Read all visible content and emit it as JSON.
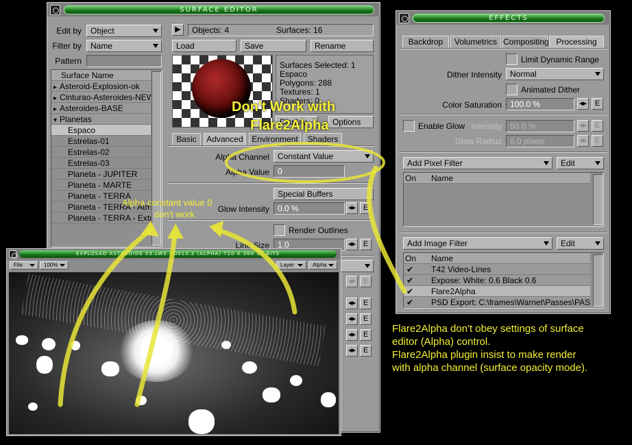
{
  "surface_editor": {
    "title": "Surface Editor",
    "edit_by_label": "Edit by",
    "edit_by_value": "Object",
    "filter_by_label": "Filter by",
    "filter_by_value": "Name",
    "pattern_label": "Pattern",
    "pattern_value": "",
    "list_header": "Surface Name",
    "groups": [
      {
        "name": "Asteroid-Explosion-ok",
        "expanded": false
      },
      {
        "name": "Cinturao-Asteroides-NEW E",
        "expanded": false
      },
      {
        "name": "Asteroides-BASE",
        "expanded": false
      },
      {
        "name": "Planetas",
        "expanded": true
      }
    ],
    "surfaces": [
      "Espaco",
      "Estrelas-01",
      "Estrelas-02",
      "Estrelas-03",
      "Planeta - JUPITER",
      "Planeta - MARTE",
      "Planeta - TERRA",
      "Planeta - TERRA - Atmo",
      "Planeta - TERRA - Extra"
    ],
    "selected_surface": "Espaco",
    "objects_text": "Objects: 4",
    "surfaces_count_text": "Surfaces: 16",
    "load_label": "Load",
    "save_label": "Save",
    "rename_label": "Rename",
    "info": [
      "Surfaces Selected: 1",
      "Espaco",
      "Polygons: 288",
      "Textures: 1",
      "Shaders: 0"
    ],
    "display_label": "Display",
    "options_label": "Options",
    "tabs": [
      "Basic",
      "Advanced",
      "Environment",
      "Shaders"
    ],
    "selected_tab": "Advanced",
    "alpha_channel_label": "Alpha Channel",
    "alpha_channel_value": "Constant Value",
    "alpha_value_label": "Alpha Value",
    "alpha_value": "0",
    "special_buffers_label": "Special Buffers",
    "glow_intensity_label": "Glow Intensity",
    "glow_intensity_value": "0.0 %",
    "render_outlines_label": "Render Outlines",
    "line_size_label": "Line Size",
    "line_size_value": "1.0",
    "env_button_label": "E"
  },
  "effects": {
    "title": "Effects",
    "tabs": [
      "Backdrop",
      "Volumetrics",
      "Compositing",
      "Processing"
    ],
    "selected_tab": "Processing",
    "limit_dynamic_range_label": "Limit Dynamic Range",
    "dither_intensity_label": "Dither Intensity",
    "dither_intensity_value": "Normal",
    "animated_dither_label": "Animated Dither",
    "color_saturation_label": "Color Saturation",
    "color_saturation_value": "100.0 %",
    "enable_glow_label": "Enable Glow",
    "intensity_label": "Intensity",
    "intensity_value": "50.0 %",
    "glow_radius_label": "Glow Radius",
    "glow_radius_value": "8.0 pixels",
    "add_pixel_filter_label": "Add Pixel Filter",
    "edit_label": "Edit",
    "col_on": "On",
    "col_name": "Name",
    "add_image_filter_label": "Add Image Filter",
    "image_filters": [
      {
        "on": true,
        "name": "T42 Video-Lines"
      },
      {
        "on": true,
        "name": "Expose: White:  0.6 Black   0.6"
      },
      {
        "on": true,
        "name": "Flare2Alpha"
      },
      {
        "on": true,
        "name": "PSD Export: C:\\frames\\Warnet\\Passes\\PASS."
      }
    ],
    "check_glyph": "✔",
    "env_button_label": "E"
  },
  "render_window": {
    "title": "Explosao Asteroide 03.lws - 0013.2 (Alpha) 720 x 360 32 bits",
    "file_menu": "File",
    "zoom_value": "100%",
    "layer_menu": "Layer",
    "alpha_menu": "Alpha"
  },
  "annotations": {
    "dont_work_line1": "Don't Work with",
    "dont_work_line2": "Flare2Alpha",
    "alpha_const_line1": "Alpha constant value 0",
    "alpha_const_line2": "don't work",
    "note_lines": [
      "Flare2Alpha don't obey settings of surface",
      "editor (Alpha) control.",
      "Flare2Alpha plugin insist to make render",
      "with alpha channel (surface opacity mode)."
    ],
    "color": "#f3f035"
  }
}
